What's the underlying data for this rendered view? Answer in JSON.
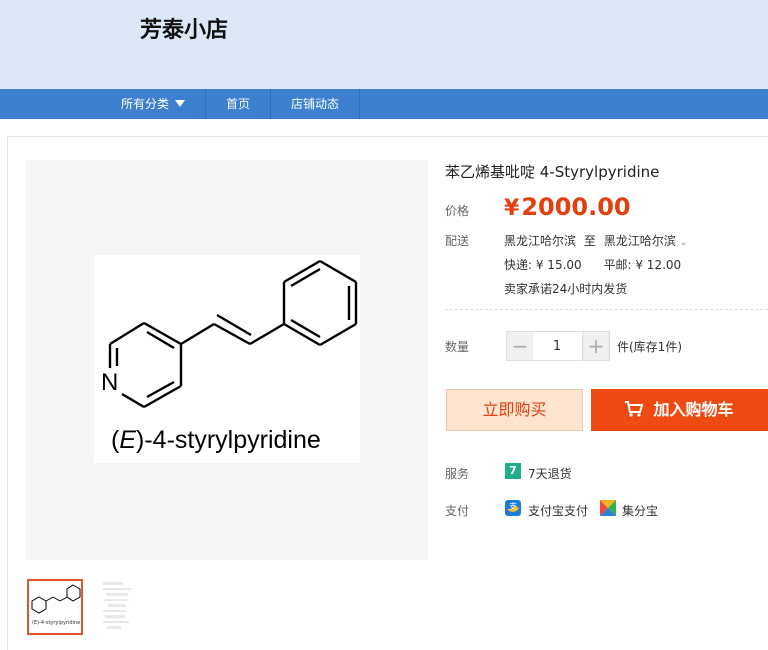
{
  "shop": {
    "name": "芳泰小店"
  },
  "nav": {
    "all_categories": "所有分类",
    "home": "首页",
    "shop_news": "店铺动态"
  },
  "product": {
    "title": "苯乙烯基吡啶 4-Styrylpyridine",
    "image_caption": "(E)-4-styrylpyridine",
    "image_caption_italic": "E",
    "image_caption_suffix": ")-4-styrylpyridine",
    "image_caption_prefix": "(",
    "atom_label": "N",
    "thumbnail_caption": "(E)-4-styrylpyridine"
  },
  "price": {
    "label": "价格",
    "currency": "¥",
    "value": "2000.00"
  },
  "shipping": {
    "label": "配送",
    "from": "黑龙江哈尔滨",
    "to_word": "至",
    "to": "黑龙江哈尔滨",
    "express": "快递: ¥ 15.00",
    "standard": "平邮: ¥ 12.00",
    "promise": "卖家承诺24小时内发货"
  },
  "quantity": {
    "label": "数量",
    "minus": "−",
    "plus": "+",
    "value": "1",
    "stock": "件(库存1件)"
  },
  "buttons": {
    "buy_now": "立即购买",
    "add_to_cart": "加入购物车"
  },
  "service": {
    "label": "服务",
    "icon_text": "7",
    "text": "7天退货"
  },
  "payment": {
    "label": "支付",
    "alipay": "支付宝支付",
    "jifenbao": "集分宝"
  },
  "colors": {
    "accent_orange": "#ef4a12",
    "price_red": "#e4400f",
    "nav_blue": "#3d80cf",
    "header_bg": "#dce8f7",
    "service_green": "#1fae8c"
  }
}
